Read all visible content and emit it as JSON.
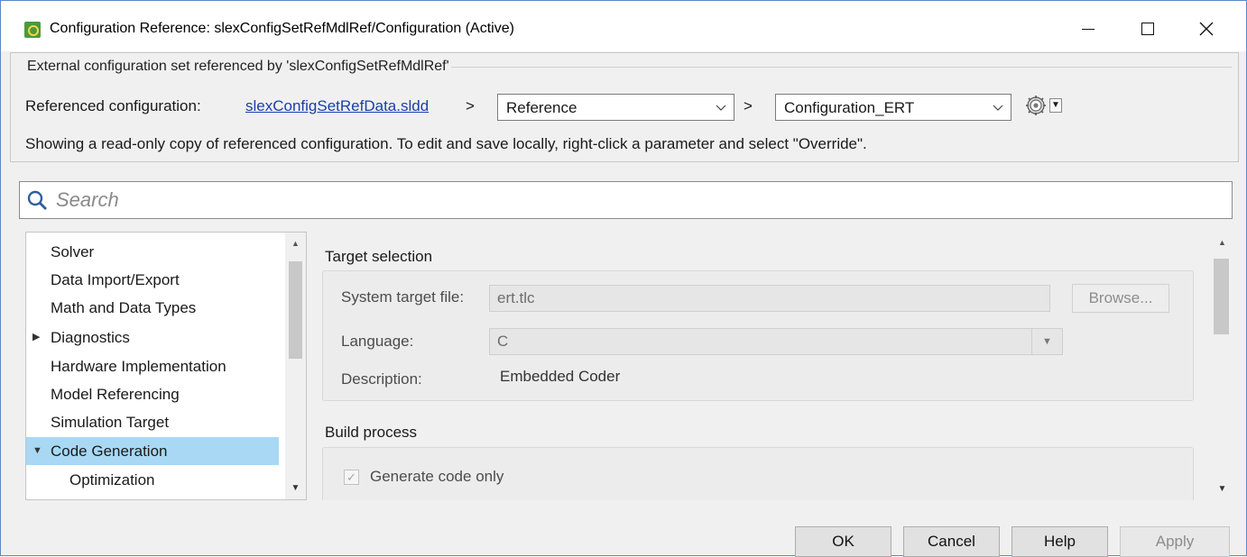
{
  "window": {
    "title": "Configuration Reference: slexConfigSetRefMdlRef/Configuration (Active)",
    "controls": {
      "minimize": "minimize-icon",
      "maximize": "maximize-icon",
      "close": "close-icon"
    }
  },
  "header": {
    "caption": "External configuration set referenced by 'slexConfigSetRefMdlRef'",
    "referenced_label": "Referenced configuration:",
    "data_dictionary_link": "slexConfigSetRefData.sldd",
    "separator": ">",
    "reference_select": {
      "value": "Reference"
    },
    "configuration_select": {
      "value": "Configuration_ERT"
    },
    "gear_icon": "gear-icon",
    "info": "Showing a read-only copy of referenced configuration. To edit and save locally, right-click a parameter and select \"Override\"."
  },
  "search": {
    "placeholder": "Search",
    "icon": "search-icon"
  },
  "tree": {
    "items": [
      {
        "label": "Solver"
      },
      {
        "label": "Data Import/Export"
      },
      {
        "label": "Math and Data Types"
      },
      {
        "label": "Diagnostics",
        "expander": "▶"
      },
      {
        "label": "Hardware Implementation"
      },
      {
        "label": "Model Referencing"
      },
      {
        "label": "Simulation Target"
      },
      {
        "label": "Code Generation",
        "expander": "▼",
        "selected": true
      },
      {
        "label": "Optimization"
      }
    ]
  },
  "target_selection": {
    "title": "Target selection",
    "system_target_file_label": "System target file:",
    "system_target_file_value": "ert.tlc",
    "browse_label": "Browse...",
    "language_label": "Language:",
    "language_value": "C",
    "description_label": "Description:",
    "description_value": "Embedded Coder"
  },
  "build_process": {
    "title": "Build process",
    "generate_code_only_label": "Generate code only",
    "generate_code_only_checked": true,
    "check_glyph": "✓"
  },
  "buttons": {
    "ok": "OK",
    "cancel": "Cancel",
    "help": "Help",
    "apply": "Apply"
  },
  "colors": {
    "selection": "#a8d8f4",
    "link": "#1a3fa8",
    "window_bg": "#f0f0f0"
  }
}
